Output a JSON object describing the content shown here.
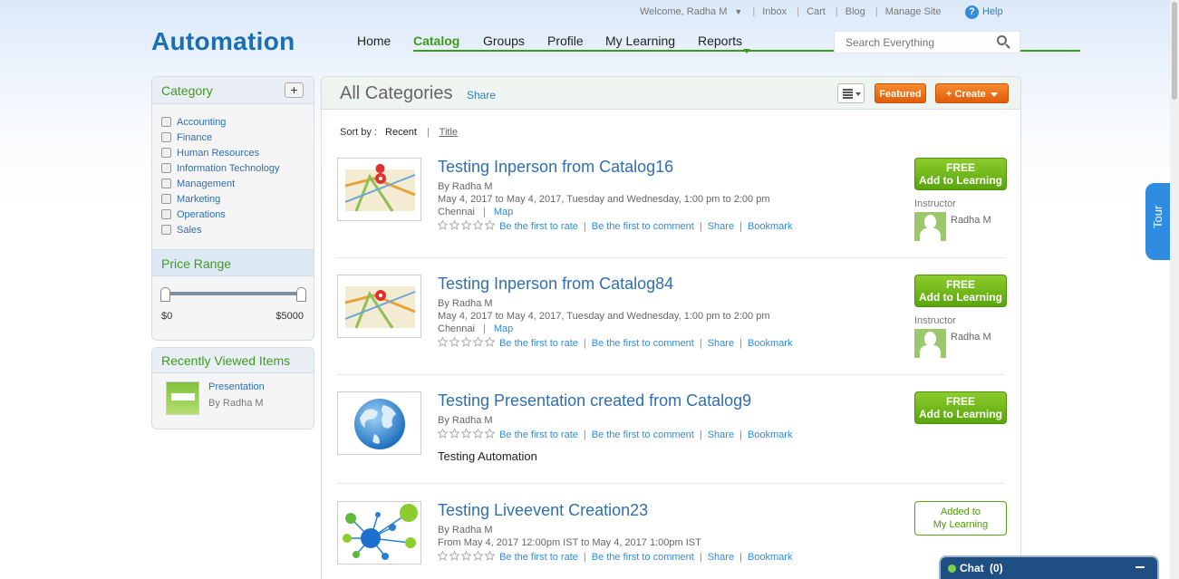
{
  "topbar": {
    "welcome": "Welcome, Radha M",
    "inbox": "Inbox",
    "cart": "Cart",
    "blog": "Blog",
    "manage": "Manage Site",
    "help": "Help"
  },
  "logo": "Automation",
  "nav": {
    "home": "Home",
    "catalog": "Catalog",
    "groups": "Groups",
    "profile": "Profile",
    "my_learning": "My Learning",
    "reports": "Reports"
  },
  "search": {
    "placeholder": "Search Everything"
  },
  "sidebar": {
    "category_title": "Category",
    "categories": [
      "Accounting",
      "Finance",
      "Human Resources",
      "Information Technology",
      "Management",
      "Marketing",
      "Operations",
      "Sales"
    ],
    "price_title": "Price Range",
    "price_min": "$0",
    "price_max": "$5000",
    "recent_title": "Recently Viewed Items",
    "recent_item": {
      "title": "Presentation",
      "by": "By Radha M"
    }
  },
  "main": {
    "title": "All Categories",
    "share": "Share",
    "featured": "Featured",
    "create": "+ Create",
    "sort_label": "Sort by :",
    "sort_recent": "Recent",
    "sort_title": "Title",
    "rate": "Be the first to rate",
    "comment": "Be the first to comment",
    "share_link": "Share",
    "bookmark": "Bookmark",
    "free": "FREE",
    "add": "Add to Learning",
    "added1": "Added to",
    "added2": "My Learning",
    "instructor": "Instructor",
    "map": "Map",
    "items": [
      {
        "title": "Testing Inperson from Catalog16",
        "by": "By Radha M",
        "date": "May 4, 2017 to May 4, 2017, Tuesday and Wednesday, 1:00 pm to 2:00 pm",
        "location": "Chennai",
        "instructor": "Radha M"
      },
      {
        "title": "Testing Inperson from Catalog84",
        "by": "By Radha M",
        "date": "May 4, 2017 to May 4, 2017, Tuesday and Wednesday, 1:00 pm to 2:00 pm",
        "location": "Chennai",
        "instructor": "Radha M"
      },
      {
        "title": "Testing Presentation created from Catalog9",
        "by": "By Radha M",
        "desc": "Testing Automation"
      },
      {
        "title": "Testing Liveevent Creation23",
        "by": "By Radha M",
        "date": "From May 4, 2017 12:00pm IST to May 4, 2017 1:00pm IST"
      }
    ]
  },
  "tour": "Tour",
  "chat": {
    "label": "Chat",
    "count": "(0)"
  },
  "colors": {
    "brand": "#1a6fb3",
    "accent_green": "#3d9b1b",
    "orange": "#e8650f",
    "link": "#2f7fc1"
  }
}
